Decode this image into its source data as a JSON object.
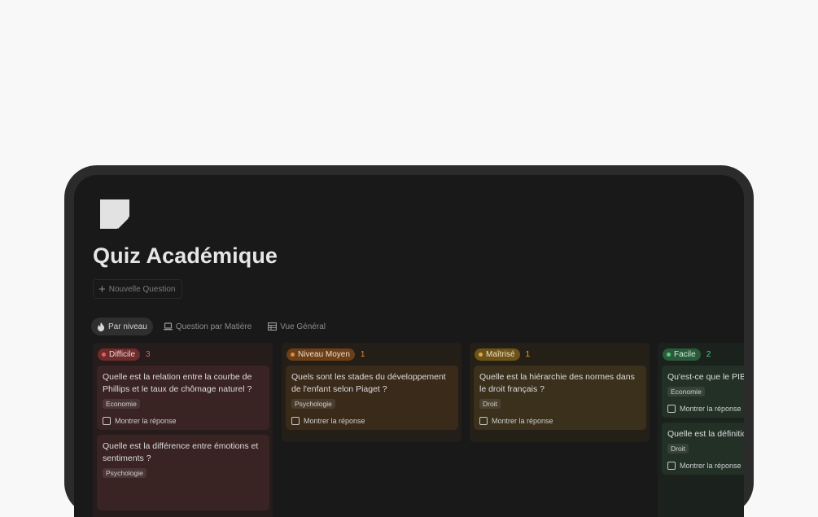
{
  "app": {
    "title": "Quiz Académique",
    "new_question_label": "Nouvelle Question"
  },
  "tabs": [
    {
      "label": "Par niveau",
      "icon": "fire-icon",
      "active": true
    },
    {
      "label": "Question par Matière",
      "icon": "laptop-icon",
      "active": false
    },
    {
      "label": "Vue Général",
      "icon": "table-icon",
      "active": false
    }
  ],
  "columns": [
    {
      "label": "Difficile",
      "count": "3",
      "colors": {
        "col_bg": "#261c1c",
        "card_bg": "#3a2323",
        "badge_bg": "#6e2b2b",
        "dot": "#e06060",
        "count": "#e06060",
        "text": "#f1d4d4"
      },
      "cards": [
        {
          "question": "Quelle est la relation entre la courbe de Phillips et le taux de chômage naturel ?",
          "subject": "Economie",
          "show_label": "Montrer la réponse"
        },
        {
          "question": "Quelle est la différence entre émotions et sentiments ?",
          "subject": "Psychologie",
          "show_label": ""
        }
      ]
    },
    {
      "label": "Niveau Moyen",
      "count": "1",
      "colors": {
        "col_bg": "#241e18",
        "card_bg": "#3a2a1a",
        "badge_bg": "#6b3f18",
        "dot": "#e08a3e",
        "count": "#e08a3e",
        "text": "#f3dcc6"
      },
      "cards": [
        {
          "question": "Quels sont les stades du développement de l'enfant selon Piaget ?",
          "subject": "Psychologie",
          "show_label": "Montrer la réponse"
        }
      ]
    },
    {
      "label": "Maîtrisé",
      "count": "1",
      "colors": {
        "col_bg": "#242018",
        "card_bg": "#3a301c",
        "badge_bg": "#6d5319",
        "dot": "#e0a940",
        "count": "#e0a940",
        "text": "#f2e2c0"
      },
      "cards": [
        {
          "question": "Quelle est la hiérarchie des normes dans le droit français ?",
          "subject": "Droit",
          "show_label": "Montrer la réponse"
        }
      ]
    },
    {
      "label": "Facile",
      "count": "2",
      "colors": {
        "col_bg": "#1b221e",
        "card_bg": "#223026",
        "badge_bg": "#2a5a3a",
        "dot": "#4fcf80",
        "count": "#4fcf80",
        "text": "#cdeeda"
      },
      "cards": [
        {
          "question": "Qu'est-ce que le PIB et",
          "subject": "Economie",
          "show_label": "Montrer la réponse"
        },
        {
          "question": "Quelle est la définition",
          "subject": "Droit",
          "show_label": "Montrer la réponse"
        }
      ]
    }
  ]
}
